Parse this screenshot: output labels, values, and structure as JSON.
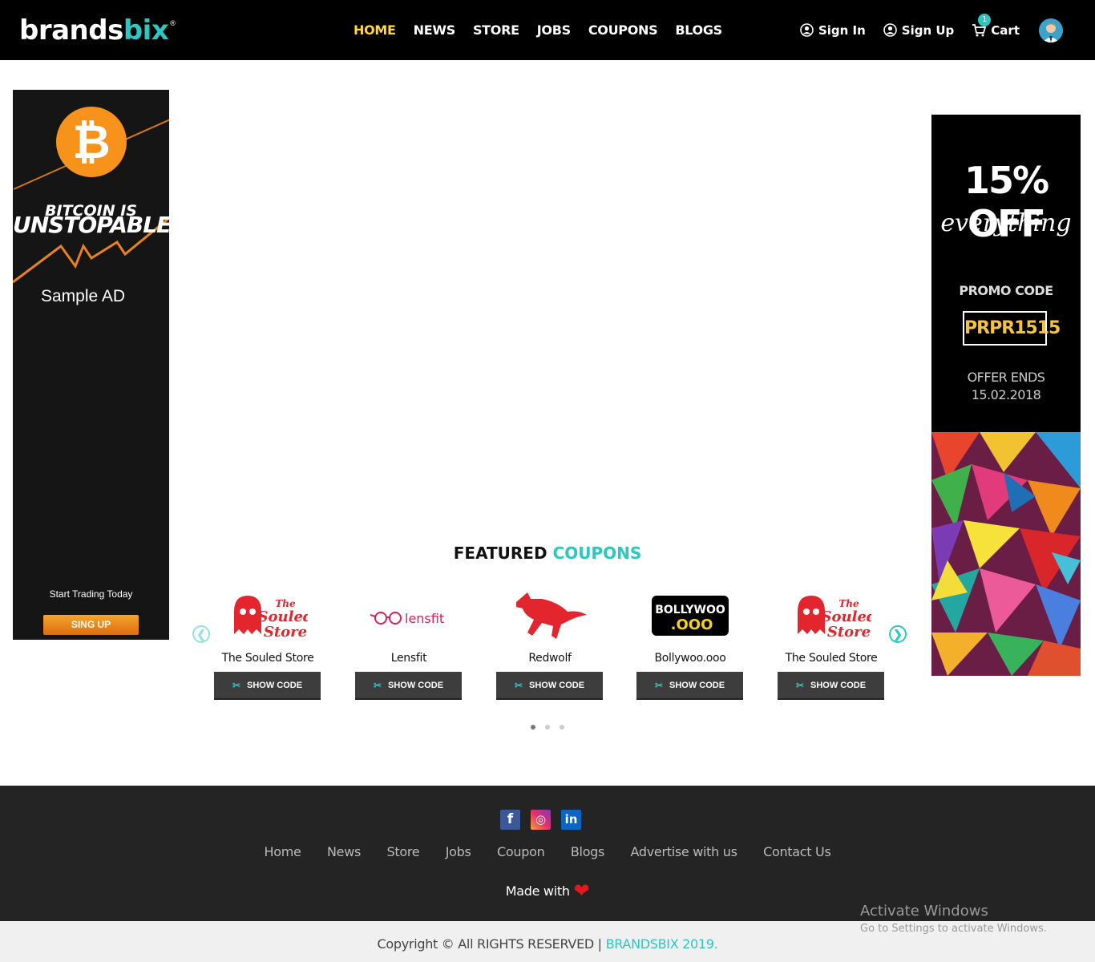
{
  "header": {
    "logo_part1": "brands",
    "logo_part2": "bix",
    "logo_reg": "®",
    "nav": [
      "HOME",
      "NEWS",
      "STORE",
      "JOBS",
      "COUPONS",
      "BLOGS"
    ],
    "sign_in": "Sign In",
    "sign_up": "Sign Up",
    "cart": "Cart",
    "cart_count": "1"
  },
  "left_ad": {
    "coin_symbol": "₿",
    "title_line1": "BITCOIN IS",
    "title_line2": "UNSTOPABLE",
    "sample": "Sample AD",
    "start_trading": "Start Trading Today",
    "cta": "SING UP"
  },
  "right_ad": {
    "discount": "15% OFF",
    "everything": "everything",
    "promo_label": "PROMO CODE",
    "promo_code": "PRPR1515",
    "offer_ends": "OFFER ENDS",
    "offer_date": "15.02.2018"
  },
  "featured": {
    "title_a": "FEATURED",
    "title_b": "COUPONS",
    "prev": "❮",
    "next": "❯",
    "coupons": [
      {
        "name": "The Souled Store",
        "logo": "souled-store",
        "btn": "SHOW CODE"
      },
      {
        "name": "Lensfit",
        "logo": "lensfit",
        "btn": "SHOW CODE"
      },
      {
        "name": "Redwolf",
        "logo": "redwolf",
        "btn": "SHOW CODE"
      },
      {
        "name": "Bollywoo.ooo",
        "logo": "bollywoo",
        "btn": "SHOW CODE"
      },
      {
        "name": "The Souled Store",
        "logo": "souled-store",
        "btn": "SHOW CODE"
      }
    ],
    "logo_text": {
      "souled_1": "The",
      "souled_2": "Souled",
      "souled_3": "Store",
      "lensfit": "lensfit",
      "bollywoo_1": "BOLLYWOO",
      "bollywoo_2": ".OOO"
    }
  },
  "footer": {
    "nav": [
      "Home",
      "News",
      "Store",
      "Jobs",
      "Coupon",
      "Blogs",
      "Advertise with us",
      "Contact Us"
    ],
    "made_with": "Made with",
    "heart": "❤",
    "copyright": "Copyright © All RIGHTS RESERVED |",
    "brand": "BRANDSBIX 2019."
  },
  "windows": {
    "line1": "Activate Windows",
    "line2": "Go to Settings to activate Windows."
  },
  "colors": {
    "accent": "#2cc7c0",
    "active_nav": "#ffd83c",
    "header_bg": "#000000",
    "footer_bg": "#242424"
  }
}
